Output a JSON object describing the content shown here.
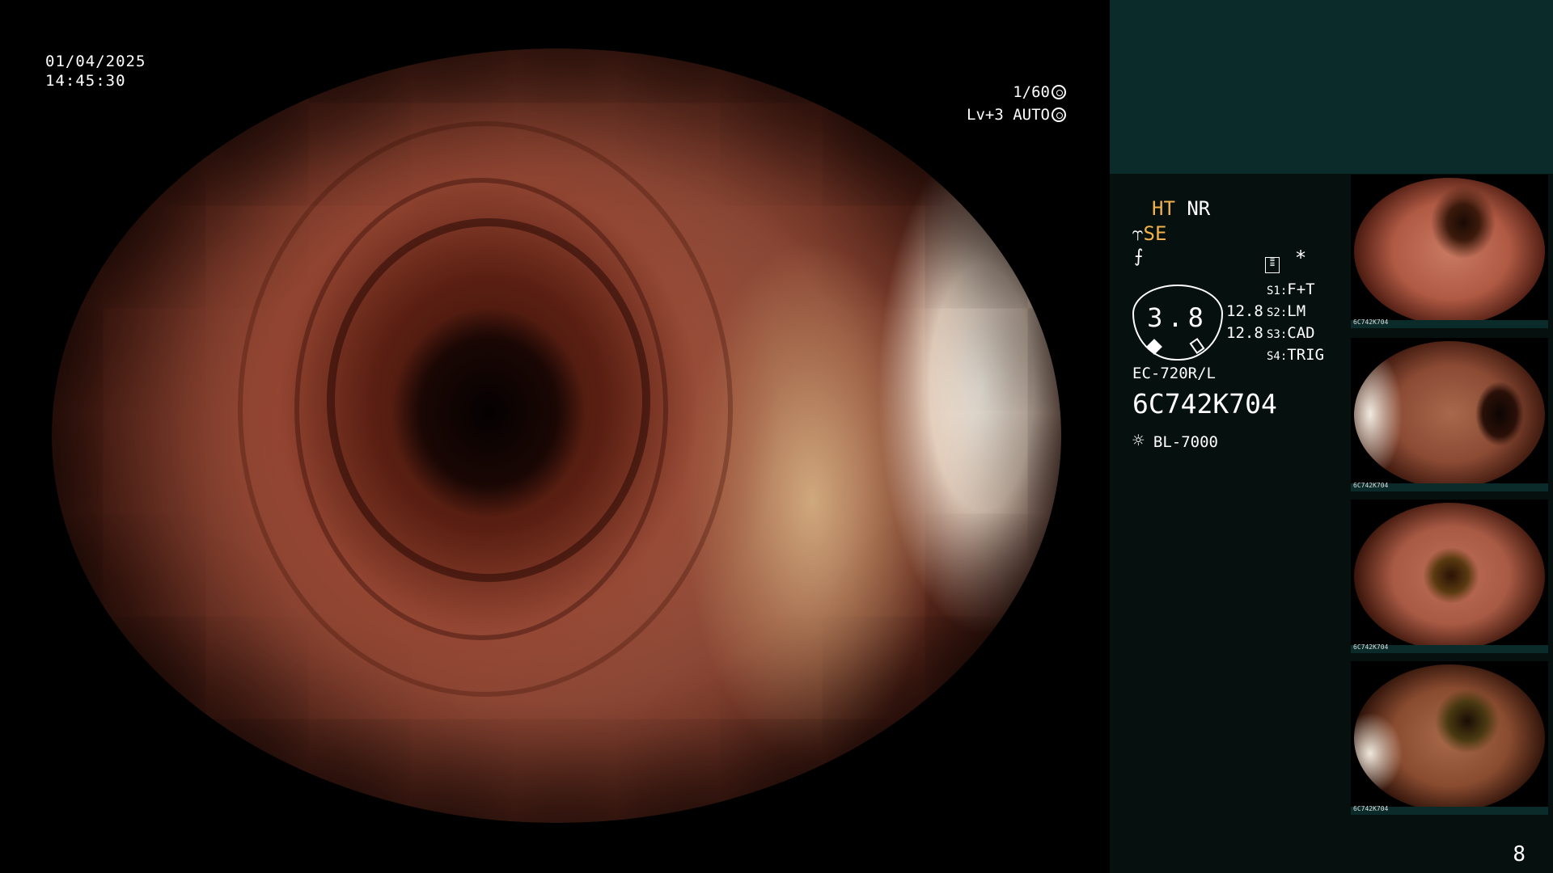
{
  "overlay": {
    "date": "01/04/2025",
    "time": "14:45:30",
    "shutter": "1/60",
    "level_mode": "Lv+3 AUTO"
  },
  "panel": {
    "ht": "HT",
    "nr": "NR",
    "se": "SE",
    "gauge_value": "3.8",
    "gauge_right_1": "12.8",
    "gauge_right_2": "12.8",
    "s1_label": "S1:",
    "s1_value": "F+T",
    "s2_label": "S2:",
    "s2_value": "LM",
    "s3_label": "S3:",
    "s3_value": "CAD",
    "s4_label": "S4:",
    "s4_value": "TRIG",
    "asterisk": "*",
    "scope_model": "EC-720R/L",
    "scope_serial": "6C742K704",
    "light_source": "BL-7000",
    "page_number": "8"
  },
  "thumbnails": [
    {
      "label": "6C742K704"
    },
    {
      "label": "6C742K704"
    },
    {
      "label": "6C742K704"
    },
    {
      "label": "6C742K704"
    }
  ]
}
